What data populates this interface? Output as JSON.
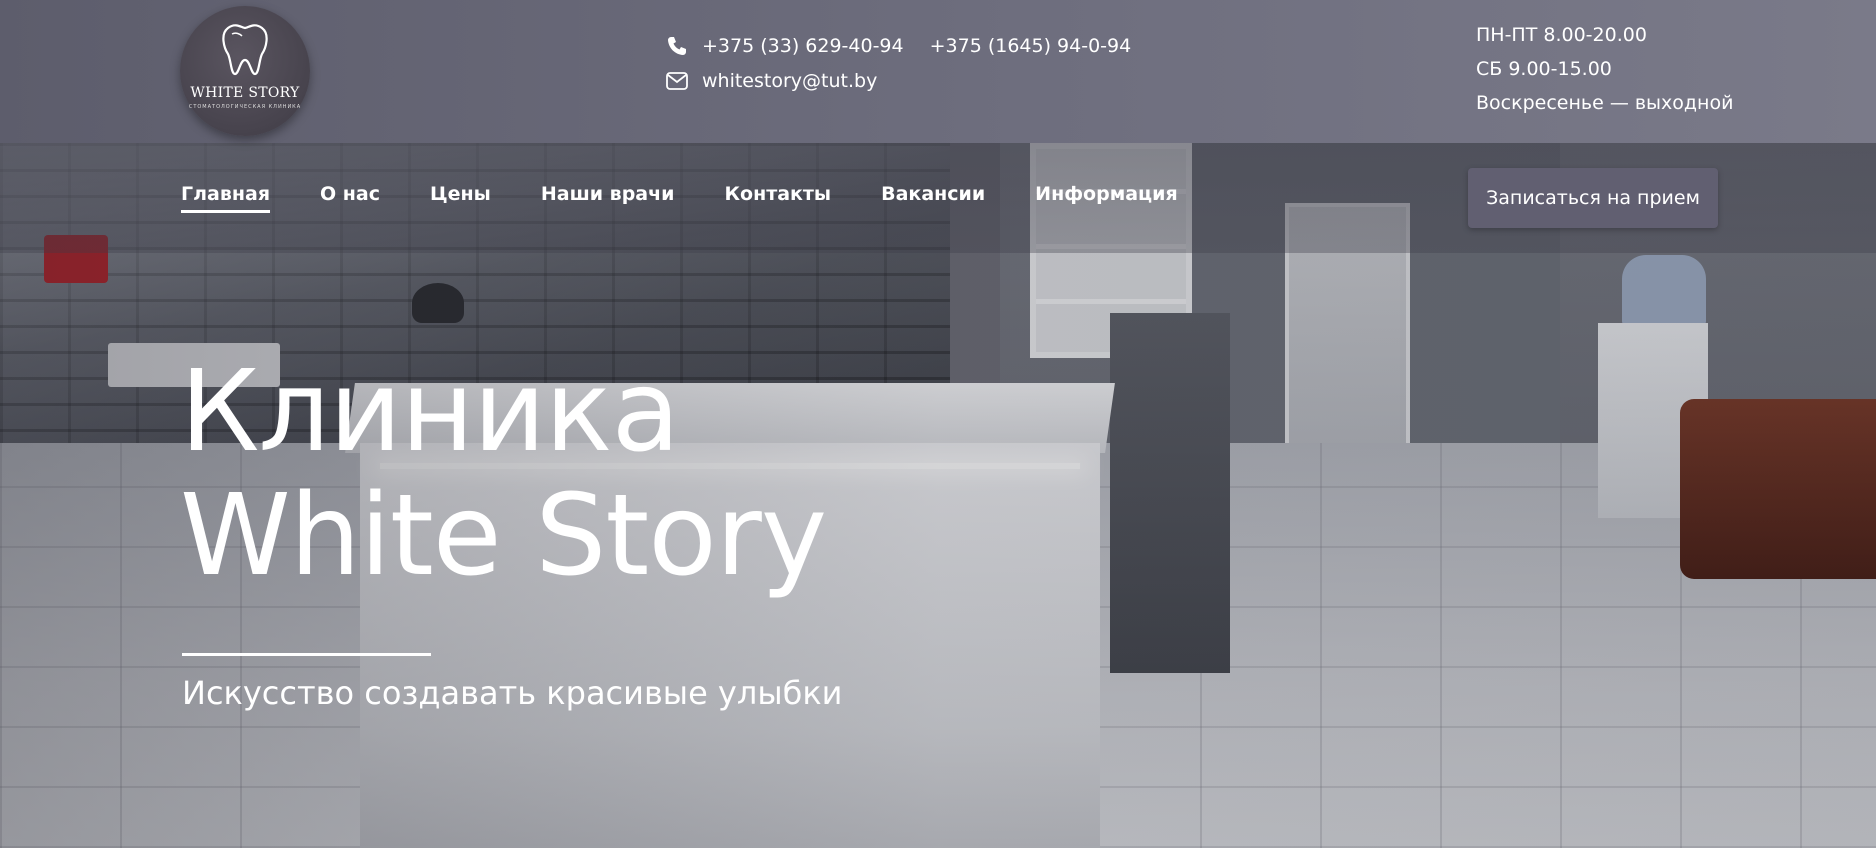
{
  "brand": {
    "logo_title": "WHITE STORY",
    "logo_subtitle": "СТОМАТОЛОГИЧЕСКАЯ КЛИНИКА",
    "logo_icon": "tooth-icon"
  },
  "header": {
    "phone_icon": "phone-icon",
    "phone_1": "+375 (33) 629-40-94",
    "phone_2": "+375 (1645) 94-0-94",
    "email_icon": "envelope-icon",
    "email": "whitestory@tut.by",
    "hours_weekdays": "ПН-ПТ 8.00-20.00",
    "hours_saturday": "СБ 9.00-15.00",
    "hours_sunday": "Воскресенье — выходной"
  },
  "nav": {
    "items": [
      {
        "label": "Главная",
        "active": true
      },
      {
        "label": "О нас"
      },
      {
        "label": "Цены"
      },
      {
        "label": "Наши врачи"
      },
      {
        "label": "Контакты"
      },
      {
        "label": "Вакансии"
      },
      {
        "label": "Информация"
      }
    ],
    "cta_label": "Записаться на прием"
  },
  "hero": {
    "title_line_1": "Клиника",
    "title_line_2": "White Story",
    "tagline": "Искусство создавать красивые улыбки"
  },
  "colors": {
    "header_bg": "#6a6a79",
    "cta_bg": "#615f71",
    "text": "#ffffff"
  }
}
